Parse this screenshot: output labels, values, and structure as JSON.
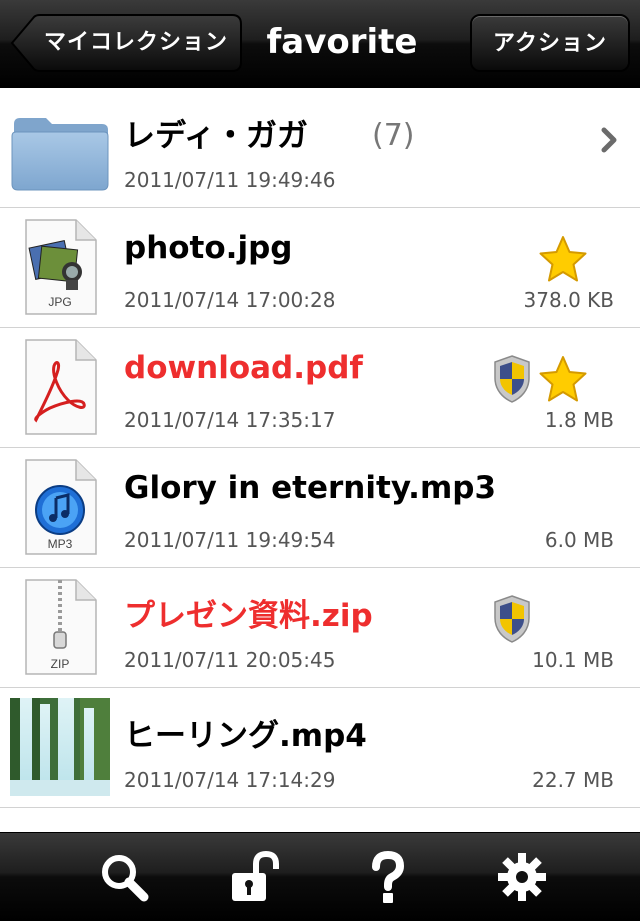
{
  "navbar": {
    "back_label": "マイコレクション",
    "title": "favorite",
    "action_label": "アクション"
  },
  "items": [
    {
      "name": "レディ・ガガ",
      "count": "(7)",
      "date": "2011/07/11 19:49:46",
      "size": "",
      "type": "folder",
      "protected": false,
      "favorite": false
    },
    {
      "name": "photo.jpg",
      "date": "2011/07/14 17:00:28",
      "size": "378.0 KB",
      "type": "jpg",
      "icon_label": "JPG",
      "protected": false,
      "favorite": true
    },
    {
      "name": "download.pdf",
      "date": "2011/07/14 17:35:17",
      "size": "1.8 MB",
      "type": "pdf",
      "protected": true,
      "favorite": true
    },
    {
      "name": "Glory in eternity.mp3",
      "date": "2011/07/11 19:49:54",
      "size": "6.0 MB",
      "type": "mp3",
      "icon_label": "MP3",
      "protected": false,
      "favorite": false
    },
    {
      "name": "プレゼン資料.zip",
      "date": "2011/07/11 20:05:45",
      "size": "10.1 MB",
      "type": "zip",
      "icon_label": "ZIP",
      "protected": true,
      "favorite": false
    },
    {
      "name": "ヒーリング.mp4",
      "date": "2011/07/14 17:14:29",
      "size": "22.7 MB",
      "type": "mp4",
      "protected": false,
      "favorite": false
    }
  ],
  "toolbar": {
    "icons": [
      "search-icon",
      "unlock-icon",
      "help-icon",
      "gear-icon"
    ]
  },
  "colors": {
    "protected_name": "#ee2e2e",
    "star": "#ffcc00",
    "folder": "#8fb4d8"
  }
}
